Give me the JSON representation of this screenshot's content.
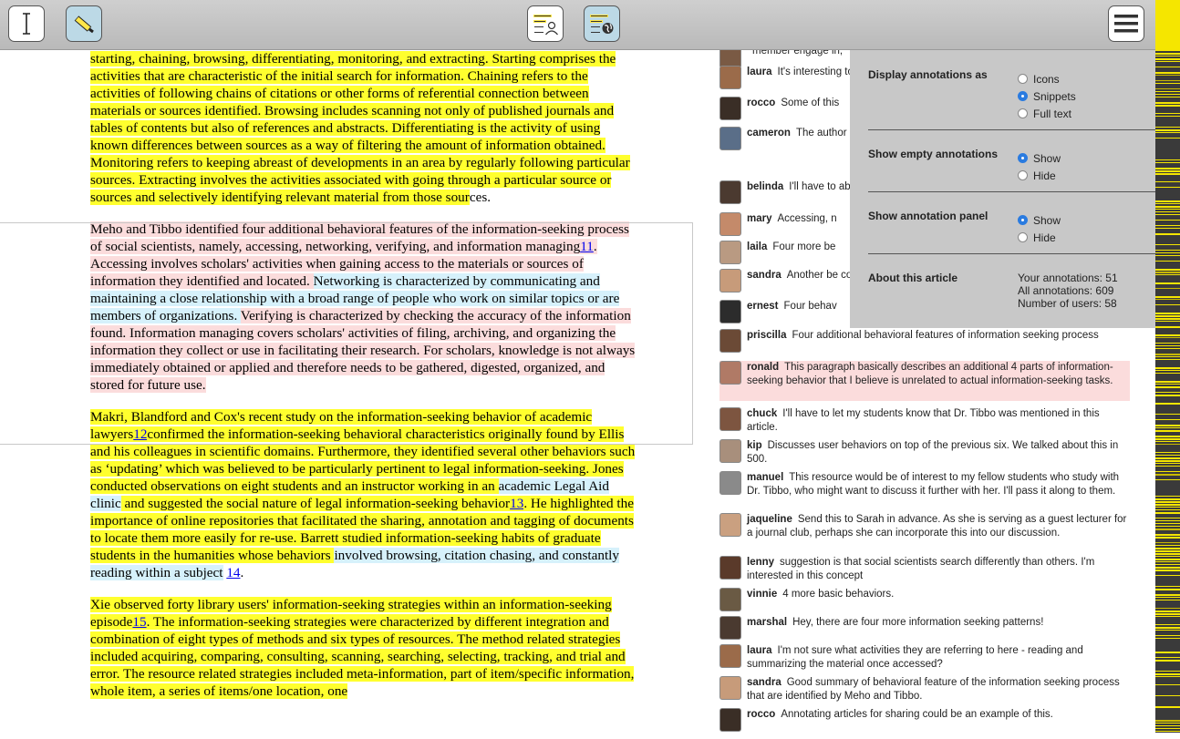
{
  "toolbar": {
    "buttons": [
      {
        "name": "text-select-button",
        "icon": "text-cursor-icon",
        "active": false
      },
      {
        "name": "highlighter-button",
        "icon": "highlighter-icon",
        "active": true
      },
      {
        "name": "user-annotations-button",
        "icon": "user-notes-icon",
        "active": false
      },
      {
        "name": "public-annotations-button",
        "icon": "globe-notes-icon",
        "active": true
      },
      {
        "name": "menu-button",
        "icon": "hamburger-menu-icon",
        "active": false
      }
    ]
  },
  "colors": {
    "yellow_highlight": "#ffff2e",
    "pink_highlight": "#fbdcdc",
    "blue_highlight": "#d6f1fb",
    "toolbar": "#c4c4c4",
    "settings_panel": "#c8c8c8",
    "radio_selected": "#2a7be0",
    "link": "#0000ee"
  },
  "article": {
    "paragraphs": [
      [
        {
          "t": "starting, chaining, browsing, differentiating, monitoring, and extracting. Starting comprises the activities that are characteristic of the initial search for information. Chaining refers to the activities of following chains of citations or other forms of referential connection between materials or sources identified. Browsing includes scanning not only of published journals and tables of contents but also of references and abstracts. Differentiating is the activity of using known differences between sources as a way of filtering the amount of information obtained. Monitoring refers to keeping abreast of developments in an area by regularly following particular sources. Extracting involves the activities associated with going through a particular source or sources and selectively identifying relevant material from those sour",
          "c": "y"
        },
        {
          "t": "ces.",
          "c": "n"
        }
      ],
      [
        {
          "t": "Meho and Tibbo identified four additional behavioral features of the information-seeking process of social scientists, namely, accessing, networking, verifying, and information managing",
          "c": "p"
        },
        {
          "t": "11",
          "c": "p",
          "link": true
        },
        {
          "t": ". ",
          "c": "p"
        },
        {
          "t": "Accessing involves scholars' activities when gaining access to the materials or sources of information they identified and located. ",
          "c": "p"
        },
        {
          "t": "Networking is characterized by communicating and maintaining a close relationship with a broad range of people who work on similar topics or are members of organizations. ",
          "c": "b"
        },
        {
          "t": "Verifying is characterized by checking the accuracy of the information found. ",
          "c": "p"
        },
        {
          "t": "Information managing covers scholars' activities of filing, archiving, and organizing the information they collect or use in facilitating their research. For scholars, knowledge is not always immediately obtained or applied and therefore needs to be gathered, digested, organized, and stored for future use.",
          "c": "p"
        }
      ],
      [
        {
          "t": "Makri, Blandford and Cox's recent study on the information-seeking behavior of academic lawyers",
          "c": "y"
        },
        {
          "t": "12",
          "c": "y",
          "link": true
        },
        {
          "t": "confirmed the information-seeking behavioral characteristics originally found by Ellis and his colleagues in scientific domains. Furthermore, they identified several other behaviors such as ‘updating’ which was believed to be particularly pertinent to legal information-seeking. Jones conducted observations on eight students and an instructor working in an ",
          "c": "y"
        },
        {
          "t": "academic Legal Aid clinic",
          "c": "b"
        },
        {
          "t": " and suggested the social nature of legal information-seeking behavior",
          "c": "y"
        },
        {
          "t": "13",
          "c": "y",
          "link": true
        },
        {
          "t": ". He highlighted the importance of online repositories that facilitated the sharing, annotation and tagging of documents to locate them more easily for re-use. Barrett studied information-seeking habits of graduate students in the humanities whose behaviors ",
          "c": "y"
        },
        {
          "t": "involved browsing, citation chasing, and constantly reading within a subject",
          "c": "b"
        },
        {
          "t": " ",
          "c": "n"
        },
        {
          "t": "14",
          "c": "n",
          "link": true
        },
        {
          "t": ".",
          "c": "n"
        }
      ],
      [
        {
          "t": "Xie observed forty library users' information-seeking strategies within an information-seeking episode",
          "c": "y"
        },
        {
          "t": "15",
          "c": "y",
          "link": true
        },
        {
          "t": ". The information-seeking strategies were characterized by different integration and combination of eight types of methods and six types of resources. The method related strategies included acquiring, comparing, consulting, scanning, searching, selecting, tracking, and trial and error. The resource related strategies included meta-information, part of item/specific information, whole item, a series of items/one location, one",
          "c": "y"
        }
      ]
    ]
  },
  "annotations": [
    {
      "user": "",
      "text": "member engage in,",
      "avatar": "#7a5a44"
    },
    {
      "user": "laura",
      "text": "It's interesting to me how they use articles to then read",
      "avatar": "#9b6b4a"
    },
    {
      "user": "rocco",
      "text": "Some of this",
      "avatar": "#3a2e26"
    },
    {
      "user": "cameron",
      "text": "The author information seeking",
      "avatar": "#5a6e88"
    },
    {
      "user": "belinda",
      "text": "I'll have to about information m",
      "avatar": "#4b3a30"
    },
    {
      "user": "mary",
      "text": "Accessing, n",
      "avatar": "#c48a6a"
    },
    {
      "user": "laila",
      "text": "Four more be",
      "avatar": "#b99a82"
    },
    {
      "user": "sandra",
      "text": "Another be compare this with El",
      "avatar": "#c79b7a"
    },
    {
      "user": "ernest",
      "text": "Four behav",
      "avatar": "#2c2c2c"
    },
    {
      "user": "priscilla",
      "text": "Four additional behavioral features of information seeking process",
      "avatar": "#6b4a36"
    },
    {
      "user": "ronald",
      "text": "This paragraph basically describes an additional 4 parts of information-seeking behavior that I believe is unrelated to actual information-seeking tasks.",
      "avatar": "#b07a66"
    },
    {
      "user": "chuck",
      "text": "I'll have to let my students know that Dr. Tibbo was mentioned in this article.",
      "avatar": "#7d5540"
    },
    {
      "user": "kip",
      "text": "Discusses user behaviors on top of the previous six. We talked about this in 500.",
      "avatar": "#a88f7c"
    },
    {
      "user": "manuel",
      "text": "This resource would be of interest to my fellow students who study with Dr. Tibbo, who might want to discuss it further with her. I'll pass it along to them.",
      "avatar": "#8a8a8a"
    },
    {
      "user": "jaqueline",
      "text": "Send this to Sarah in advance. As she is serving as a guest lecturer for a journal club, perhaps she can incorporate this into our discussion.",
      "avatar": "#caa080"
    },
    {
      "user": "lenny",
      "text": "suggestion is that social scientists search differently than others. I'm interested in this concept",
      "avatar": "#5a3a2a"
    },
    {
      "user": "vinnie",
      "text": "4 more basic behaviors.",
      "avatar": "#6a5a44"
    },
    {
      "user": "marshal",
      "text": "Hey, there are four more information seeking patterns!",
      "avatar": "#4a3a30"
    },
    {
      "user": "laura",
      "text": "I'm not sure what activities they are referring to here - reading and summarizing the material once accessed?",
      "avatar": "#9b6b4a"
    },
    {
      "user": "sandra",
      "text": "Good summary of behavioral feature of the information seeking process that are identified by Meho and Tibbo.",
      "avatar": "#c79b7a"
    },
    {
      "user": "rocco",
      "text": "Annotating articles for sharing could be an example of this.",
      "avatar": "#3a2e26"
    }
  ],
  "settings": {
    "display_as": {
      "label": "Display annotations as",
      "options": [
        "Icons",
        "Snippets",
        "Full text"
      ],
      "selected": "Snippets"
    },
    "empty_annotations": {
      "label": "Show empty annotations",
      "options": [
        "Show",
        "Hide"
      ],
      "selected": "Show"
    },
    "annotation_panel": {
      "label": "Show annotation panel",
      "options": [
        "Show",
        "Hide"
      ],
      "selected": "Show"
    },
    "about": {
      "label": "About this article",
      "stats": [
        "Your annotations: 51",
        "All annotations: 609",
        "Number of users: 58"
      ]
    }
  }
}
